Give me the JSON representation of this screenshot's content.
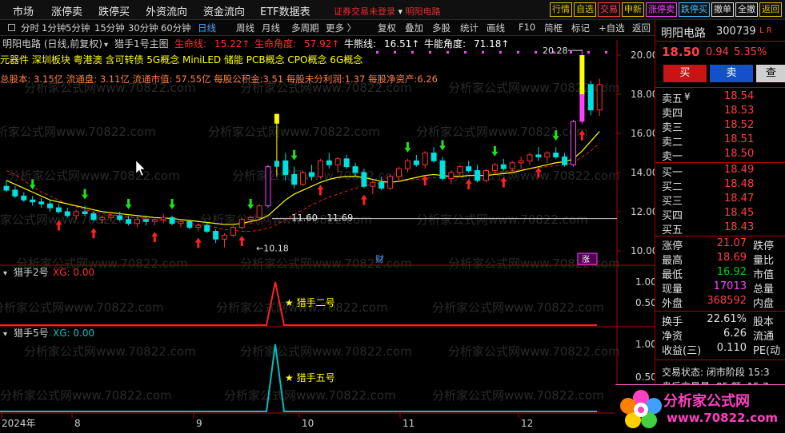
{
  "menu": [
    "市场",
    "涨停卖",
    "跌停买",
    "外资流向",
    "资金流向",
    "ETF数据表"
  ],
  "login_notice": "证券交易未登录",
  "header_stock": "明阳电路",
  "quick_buttons": [
    {
      "label": "行情",
      "color": "#e0c000"
    },
    {
      "label": "自选",
      "color": "#e0c000"
    },
    {
      "label": "交易",
      "color": "#ff4040"
    },
    {
      "label": "申新",
      "color": "#e0c000"
    },
    {
      "label": "涨停卖",
      "color": "#ff40ff"
    },
    {
      "label": "跌停买",
      "color": "#40c0ff"
    },
    {
      "label": "撤单",
      "color": "#e0e0e0"
    },
    {
      "label": "全撤",
      "color": "#e0e0e0"
    },
    {
      "label": "返回",
      "color": "#e0c000"
    }
  ],
  "periods": [
    "分时",
    "1分钟",
    "5分钟",
    "15分钟",
    "30分钟",
    "60分钟",
    "日线",
    "周线",
    "月线",
    "多周期",
    "更多 〉"
  ],
  "selected_period": "日线",
  "tools": [
    "复权",
    "叠加",
    "多股",
    "统计",
    "画线",
    "F10",
    "简框",
    "标记",
    "+自选",
    "返回"
  ],
  "watermark": "分析家公式网www.70822.com",
  "chart": {
    "title": "明阳电路 (日线,前复权)",
    "indicator": "猎手1号主图",
    "stats": [
      {
        "label": "生命线:",
        "value": "15.22↑",
        "color": "#ff3030"
      },
      {
        "label": "生命角度:",
        "value": "57.92↑",
        "color": "#ff3030"
      },
      {
        "label": "牛熊线:",
        "value": "16.51↑",
        "color": "#ffffff"
      },
      {
        "label": "牛能角度:",
        "value": "71.18↑",
        "color": "#ffffff"
      }
    ],
    "concepts": "元器件 深圳板块 粤港澳 含可转债 5G概念 MiniLED 储能 PCB概念 CPO概念 6G概念",
    "fundamentals": "总股本: 3.15亿 流通盘: 3.11亿 流通市值: 57.55亿 每股公积金:3.51 每股未分利润:1.37 每股净资产:6.26",
    "price_ticks": [
      "20.00",
      "18.00",
      "16.00",
      "14.00",
      "12.00",
      "10.00"
    ],
    "high_label": "20.28",
    "low_label": "10.18",
    "range_label": "11.60 - 11.69",
    "cai_label": "财",
    "event_label": "涨",
    "time_labels": [
      "2024年",
      "8",
      "9",
      "10",
      "11",
      "12"
    ]
  },
  "sub1": {
    "name": "猎手2号",
    "xg_label": "XG: 0.00",
    "ticks": [
      "1.00",
      "0.50"
    ],
    "star_label": "★ 猎手二号"
  },
  "sub2": {
    "name": "猎手5号",
    "xg_label": "XG: 0.00",
    "ticks": [
      "1.00",
      "0.50"
    ],
    "star_label": "★ 猎手五号"
  },
  "chart_data": {
    "type": "candlestick",
    "title": "明阳电路 (日线,前复权)",
    "ylim": [
      9.8,
      20.6
    ],
    "ohlc": [
      [
        13.3,
        13.6,
        13.0,
        13.1
      ],
      [
        13.1,
        13.3,
        12.7,
        12.8
      ],
      [
        12.8,
        13.0,
        12.5,
        12.6
      ],
      [
        12.6,
        12.8,
        12.3,
        12.5
      ],
      [
        12.5,
        12.7,
        12.2,
        12.4
      ],
      [
        12.4,
        12.6,
        12.0,
        12.2
      ],
      [
        12.2,
        12.4,
        11.9,
        12.0
      ],
      [
        12.0,
        12.2,
        11.7,
        11.8
      ],
      [
        11.8,
        12.1,
        11.6,
        12.0
      ],
      [
        12.0,
        12.3,
        11.8,
        11.9
      ],
      [
        11.9,
        12.0,
        11.5,
        11.6
      ],
      [
        11.6,
        11.8,
        11.4,
        11.7
      ],
      [
        11.7,
        12.0,
        11.5,
        11.8
      ],
      [
        11.8,
        12.0,
        11.5,
        11.6
      ],
      [
        11.6,
        11.8,
        11.3,
        11.4
      ],
      [
        11.4,
        11.7,
        11.2,
        11.6
      ],
      [
        11.6,
        11.8,
        11.3,
        11.5
      ],
      [
        11.5,
        11.7,
        11.3,
        11.6
      ],
      [
        11.6,
        11.9,
        11.4,
        11.7
      ],
      [
        11.7,
        11.8,
        11.3,
        11.4
      ],
      [
        11.4,
        11.6,
        11.2,
        11.5
      ],
      [
        11.5,
        11.6,
        11.1,
        11.2
      ],
      [
        11.2,
        11.4,
        11.0,
        11.3
      ],
      [
        11.3,
        11.5,
        10.9,
        11.0
      ],
      [
        11.0,
        11.1,
        10.4,
        10.6
      ],
      [
        10.6,
        10.9,
        10.18,
        10.8
      ],
      [
        10.8,
        11.3,
        10.7,
        11.2
      ],
      [
        11.2,
        11.7,
        11.1,
        11.6
      ],
      [
        11.6,
        11.8,
        11.4,
        11.7
      ],
      [
        11.7,
        12.4,
        11.6,
        12.3
      ],
      [
        12.3,
        14.4,
        12.2,
        14.3
      ],
      [
        14.3,
        17.0,
        13.8,
        14.6
      ],
      [
        14.6,
        15.0,
        13.6,
        13.9
      ],
      [
        13.9,
        14.3,
        13.2,
        13.4
      ],
      [
        13.4,
        14.1,
        13.3,
        14.0
      ],
      [
        14.0,
        14.4,
        13.6,
        13.8
      ],
      [
        13.8,
        14.7,
        13.7,
        14.6
      ],
      [
        14.6,
        15.0,
        14.2,
        14.4
      ],
      [
        14.4,
        14.8,
        14.0,
        14.7
      ],
      [
        14.7,
        14.9,
        14.2,
        14.3
      ],
      [
        14.3,
        14.5,
        13.8,
        14.0
      ],
      [
        14.0,
        14.2,
        13.2,
        13.3
      ],
      [
        13.3,
        13.6,
        12.9,
        13.5
      ],
      [
        13.5,
        13.8,
        13.1,
        13.2
      ],
      [
        13.2,
        13.9,
        13.1,
        13.8
      ],
      [
        13.8,
        14.3,
        13.6,
        14.2
      ],
      [
        14.2,
        14.7,
        14.0,
        14.6
      ],
      [
        14.6,
        14.9,
        14.3,
        14.4
      ],
      [
        14.4,
        15.1,
        14.2,
        15.0
      ],
      [
        15.0,
        15.3,
        14.5,
        14.6
      ],
      [
        14.6,
        14.8,
        13.6,
        13.7
      ],
      [
        13.7,
        14.1,
        13.4,
        14.0
      ],
      [
        14.0,
        14.4,
        13.8,
        14.3
      ],
      [
        14.3,
        14.6,
        14.0,
        14.1
      ],
      [
        14.1,
        14.4,
        13.5,
        13.6
      ],
      [
        13.6,
        14.2,
        13.5,
        14.1
      ],
      [
        14.1,
        14.5,
        13.9,
        14.4
      ],
      [
        14.4,
        14.7,
        14.1,
        14.2
      ],
      [
        14.2,
        14.6,
        14.0,
        14.5
      ],
      [
        14.5,
        14.8,
        14.2,
        14.6
      ],
      [
        14.6,
        15.0,
        14.4,
        14.9
      ],
      [
        14.9,
        15.3,
        14.6,
        14.8
      ],
      [
        14.8,
        15.1,
        14.5,
        15.0
      ],
      [
        15.0,
        15.3,
        14.7,
        14.8
      ],
      [
        14.8,
        15.0,
        14.3,
        14.4
      ],
      [
        14.4,
        16.7,
        14.3,
        16.6
      ],
      [
        16.6,
        20.28,
        16.5,
        18.5
      ],
      [
        18.5,
        18.69,
        16.92,
        17.2
      ],
      [
        17.2,
        18.8,
        16.9,
        18.5
      ]
    ],
    "upper_line": [
      13.6,
      13.4,
      13.2,
      13.0,
      12.8,
      12.6,
      12.5,
      12.4,
      12.3,
      12.2,
      12.1,
      12.0,
      11.95,
      11.9,
      11.85,
      11.8,
      11.75,
      11.7,
      11.68,
      11.65,
      11.6,
      11.55,
      11.5,
      11.45,
      11.4,
      11.35,
      11.35,
      11.4,
      11.5,
      11.6,
      11.8,
      12.2,
      12.6,
      12.9,
      13.1,
      13.3,
      13.5,
      13.65,
      13.75,
      13.8,
      13.8,
      13.75,
      13.65,
      13.55,
      13.5,
      13.55,
      13.65,
      13.75,
      13.85,
      13.9,
      13.85,
      13.8,
      13.8,
      13.85,
      13.85,
      13.85,
      13.9,
      13.95,
      14.0,
      14.1,
      14.2,
      14.3,
      14.4,
      14.5,
      14.55,
      14.7,
      15.1,
      15.6,
      16.1
    ],
    "lower_line": [
      14.1,
      13.9,
      13.6,
      13.3,
      13.0,
      12.8,
      12.6,
      12.4,
      12.25,
      12.1,
      12.0,
      11.9,
      11.85,
      11.8,
      11.75,
      11.7,
      11.65,
      11.6,
      11.55,
      11.5,
      11.45,
      11.4,
      11.35,
      11.3,
      11.2,
      11.1,
      11.05,
      11.0,
      11.0,
      11.05,
      11.15,
      11.35,
      11.6,
      11.85,
      12.1,
      12.35,
      12.55,
      12.75,
      12.9,
      13.05,
      13.2,
      13.3,
      13.4,
      13.45,
      13.5,
      13.55,
      13.6,
      13.65,
      13.7,
      13.75,
      13.75,
      13.75,
      13.8,
      13.85,
      13.9,
      13.95,
      14.0,
      14.05,
      14.1,
      14.15,
      14.2,
      14.25,
      14.3,
      14.35,
      14.4,
      14.5,
      14.8,
      15.1,
      15.5
    ],
    "red_arrows": [
      6,
      10,
      17,
      22,
      27,
      36,
      41,
      48,
      53,
      57,
      61,
      66
    ],
    "green_arrows": [
      3,
      9,
      14,
      19,
      28,
      33,
      46,
      50,
      56,
      63
    ]
  },
  "quote": {
    "name": "明阳电路",
    "code": "300739",
    "price": "18.50",
    "change": "0.94",
    "pct": "5.35%",
    "buy_label": "买",
    "sell_label": "卖",
    "extra_label": "查",
    "asks": [
      {
        "label": "卖五",
        "value": "18.54",
        "color": "#ff4040"
      },
      {
        "label": "卖四",
        "value": "18.53",
        "color": "#ff4040"
      },
      {
        "label": "卖三",
        "value": "18.52",
        "color": "#ff4040"
      },
      {
        "label": "卖二",
        "value": "18.51",
        "color": "#ff4040"
      },
      {
        "label": "卖一",
        "value": "18.50",
        "color": "#ff4040"
      }
    ],
    "bids": [
      {
        "label": "买一",
        "value": "18.49",
        "color": "#ff4040"
      },
      {
        "label": "买二",
        "value": "18.48",
        "color": "#ff4040"
      },
      {
        "label": "买三",
        "value": "18.47",
        "color": "#ff4040"
      },
      {
        "label": "买四",
        "value": "18.45",
        "color": "#ff4040"
      },
      {
        "label": "买五",
        "value": "18.43",
        "color": "#ff4040"
      }
    ],
    "stats": [
      {
        "l1": "涨停",
        "v1": "21.07",
        "c1": "#ff4040",
        "l2": "跌停"
      },
      {
        "l1": "最高",
        "v1": "18.69",
        "c1": "#ff4040",
        "l2": "量比"
      },
      {
        "l1": "最低",
        "v1": "16.92",
        "c1": "#00d000",
        "l2": "市值"
      },
      {
        "l1": "现量",
        "v1": "17013",
        "c1": "#ff40ff",
        "l2": "总量"
      },
      {
        "l1": "外盘",
        "v1": "368592",
        "c1": "#ff4040",
        "l2": "内盘"
      }
    ],
    "stats2": [
      {
        "l1": "换手",
        "v1": "22.61%",
        "c1": "#e0e0e0",
        "l2": "股本"
      },
      {
        "l1": "净资",
        "v1": "6.26",
        "c1": "#e0e0e0",
        "l2": "流通"
      },
      {
        "l1": "收益(三)",
        "v1": "0.110",
        "c1": "#e0e0e0",
        "l2": "PE(动"
      }
    ],
    "status": "交易状态: 闭市阶段 15:3",
    "status2": "盘后交易量: 85 额: 15.7"
  },
  "logo": {
    "text": "分析家公式网",
    "url": "www.70822.com"
  }
}
